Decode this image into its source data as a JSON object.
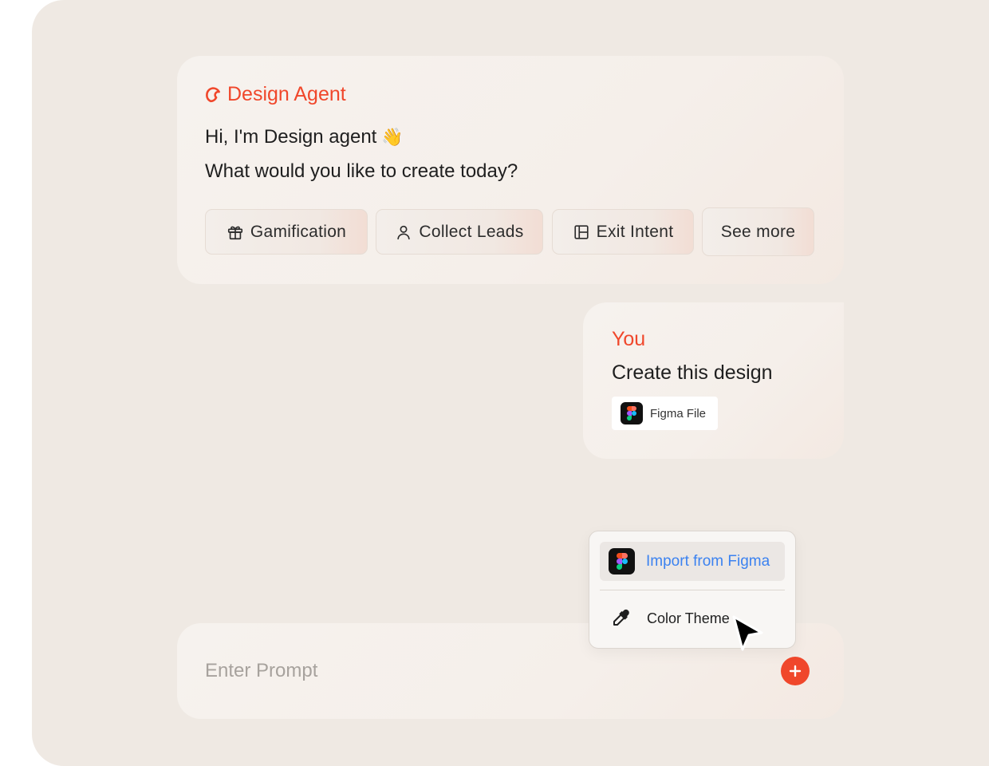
{
  "agent": {
    "name": "Design Agent",
    "greeting": "Hi, I'm Design agent",
    "greeting_emoji": "👋",
    "question": "What would you like to create today?",
    "suggestions": [
      {
        "label": "Gamification",
        "icon": "gift-icon"
      },
      {
        "label": "Collect Leads",
        "icon": "user-icon"
      },
      {
        "label": "Exit Intent",
        "icon": "layout-icon"
      },
      {
        "label": "See more"
      }
    ]
  },
  "user_message": {
    "sender": "You",
    "text": "Create this design",
    "attachment": {
      "label": "Figma File",
      "icon": "figma-icon"
    }
  },
  "menu": {
    "items": [
      {
        "label": "Import from Figma",
        "icon": "figma-icon",
        "selected": true
      },
      {
        "label": "Color Theme",
        "icon": "eyedropper-icon"
      }
    ]
  },
  "prompt": {
    "placeholder": "Enter Prompt",
    "value": ""
  },
  "colors": {
    "accent": "#f0472b",
    "link": "#3b82f0",
    "background": "#efe9e3"
  }
}
